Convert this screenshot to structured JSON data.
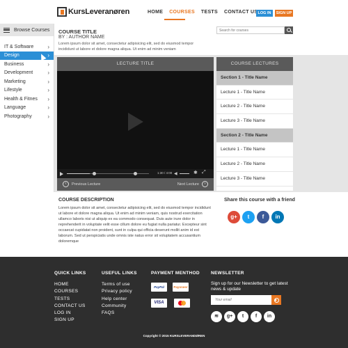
{
  "header": {
    "logo_text": "KursLeveranøren",
    "nav": [
      "HOME",
      "COURSES",
      "TESTS",
      "CONTACT US"
    ],
    "login": "LOG IN",
    "signup": "SIGN UP",
    "accent": "#e87722",
    "blue": "#2b8fd6"
  },
  "sidebar": {
    "title": "Browse Courses",
    "items": [
      {
        "label": "IT & Software"
      },
      {
        "label": "Design"
      },
      {
        "label": "Business"
      },
      {
        "label": "Development"
      },
      {
        "label": "Marketing"
      },
      {
        "label": "Lifestyle"
      },
      {
        "label": "Health & Fitnes"
      },
      {
        "label": "Language"
      },
      {
        "label": "Photography"
      }
    ]
  },
  "course": {
    "title": "COURSE TITLE",
    "author": "BY : AUTHOR NAME",
    "summary": "Lorem ipsum dolor sit amet, consectetur adipisicing elit, sed do eiusmod tempor incididunt ut labore et dolore magna aliqua. Ut enim ad minim veniam"
  },
  "search": {
    "placeholder": "Search for courses"
  },
  "player": {
    "title": "LECTURE TITLE",
    "timecode": "1:30 / 4:00",
    "prev": "Previous Lecture",
    "next": "Next Lecture",
    "progress": 0.28
  },
  "lectures": {
    "title": "COURSE LECTURES",
    "rows": [
      {
        "label": "Section 1 - Title Name",
        "section": true
      },
      {
        "label": "Lecture 1 - Title Name",
        "section": false
      },
      {
        "label": "Lecture 2 - Title Name",
        "section": false
      },
      {
        "label": "Lecture 3 - Title Name",
        "section": false
      },
      {
        "label": "Section 2 - Title Name",
        "section": true
      },
      {
        "label": "Lecture 1 - Title Name",
        "section": false
      },
      {
        "label": "Lecture 2 - Title Name",
        "section": false
      },
      {
        "label": "Lecture 3 - Title Name",
        "section": false
      }
    ]
  },
  "description": {
    "title": "COURSE DESCRIPTION",
    "body": "Lorem ipsum dolor sit amet, consectetur adipisicing elit, sed do eiusmod tempor incididunt ut labore et dolore magna aliqua. Ut enim ad minim veniam, quis nostrud exercitation ullamco laboris nisi ut aliquip ex ea commodo consequat. Duis aute irure dolor in reprehenderit in voluptate velit esse cillum dolore eu fugiat nulla pariatur. Excepteur sint occaecat cupidatat non proident, sunt in culpa qui officia deserunt mollit anim id est laborum. Sed ut perspiciatis unde omnis iste natus error sit voluptatem accusantium doloremque"
  },
  "share": {
    "title": "Share this course with a friend",
    "icons": [
      "google-plus-icon",
      "twitter-icon",
      "facebook-icon",
      "linkedin-icon"
    ]
  },
  "footer": {
    "quick_links_title": "QUICK LINKS",
    "quick_links": [
      "HOME",
      "COURSES",
      "TESTS",
      "CONTACT US",
      "LOG IN",
      "SIGN UP"
    ],
    "useful_links_title": "USEFUL LINKS",
    "useful_links": [
      "Terms of use",
      "Privacy policy",
      "Help center",
      "Community",
      "FAQS"
    ],
    "payment_title": "PAYMENT MENTHOD",
    "payment": [
      "PayPal",
      "Payoneer",
      "VISA",
      "MasterCard"
    ],
    "newsletter_title": "NEWSLETTER",
    "newsletter_text": "Sign up for our Newsletter to get latest news & update",
    "email_placeholder": "Your email",
    "social": [
      "rss-icon",
      "google-plus-icon",
      "twitter-icon",
      "facebook-icon",
      "linkedin-icon"
    ],
    "copyright": "Copyright © 2015 KURSLEVERANDØREN"
  }
}
